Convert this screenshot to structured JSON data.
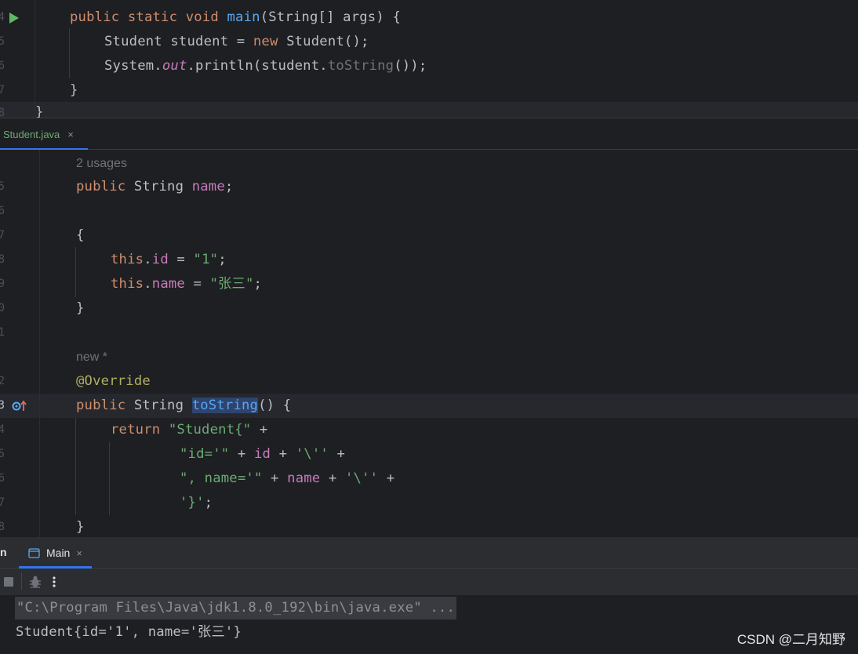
{
  "top_editor": {
    "line_numbers": [
      "4",
      "5",
      "6",
      "7",
      "8"
    ],
    "code": {
      "main_decl": [
        "public",
        "static",
        "void",
        "main",
        "(String[] args) {"
      ],
      "student_decl": [
        "Student student = ",
        "new",
        " Student();"
      ],
      "println": [
        "System.",
        "out",
        ".println(student.",
        "toString",
        "());"
      ],
      "close_brace": "}",
      "class_close": "}"
    }
  },
  "tab_bar": {
    "tabs": [
      {
        "label": "Student.java",
        "close": "×"
      }
    ]
  },
  "main_editor": {
    "line_numbers": [
      "5",
      "6",
      "7",
      "8",
      "9",
      "0",
      "1",
      "2",
      "3",
      "4",
      "5",
      "6",
      "7",
      "8"
    ],
    "inlay_usages": "2 usages",
    "inlay_new": "new *",
    "code": {
      "field_decl": [
        "public",
        " String ",
        "name",
        ";"
      ],
      "open_brace": "{",
      "this_id": [
        "this",
        ".",
        "id",
        " = ",
        "\"1\"",
        ";"
      ],
      "this_name": [
        "this",
        ".",
        "name",
        " = ",
        "\"张三\"",
        ";"
      ],
      "close_brace": "}",
      "annotation": "@Override",
      "tostring_decl": [
        "public",
        " String ",
        "toString",
        "() {"
      ],
      "return_line": [
        "return",
        " ",
        "\"Student{\"",
        " +"
      ],
      "id_line": [
        "\"id='\"",
        " + ",
        "id",
        " + ",
        "'\\''",
        " +"
      ],
      "name_line": [
        "\", name='\"",
        " + ",
        "name",
        " + ",
        "'\\''",
        " +"
      ],
      "end_line": [
        "'}'",
        ";"
      ],
      "method_close": "}"
    }
  },
  "run_panel": {
    "side_label": "n",
    "tabs": [
      {
        "label": "Main",
        "close": "×"
      }
    ],
    "console_lines": [
      "\"C:\\Program Files\\Java\\jdk1.8.0_192\\bin\\java.exe\" ...",
      "Student{id='1', name='张三'}"
    ]
  },
  "watermark": "CSDN @二月知野",
  "colors": {
    "keyword": "#cf8e6d",
    "function": "#56a8f5",
    "field": "#c77dbb",
    "string": "#6aab73",
    "annotation": "#b3ae60",
    "text": "#bcbec4",
    "accent": "#3574f0",
    "run_green": "#5fb865"
  },
  "icons": [
    "run-gutter-icon",
    "override-gutter-icon",
    "stop-icon",
    "debug-bug-icon",
    "more-vertical-icon",
    "console-icon",
    "close-icon"
  ]
}
